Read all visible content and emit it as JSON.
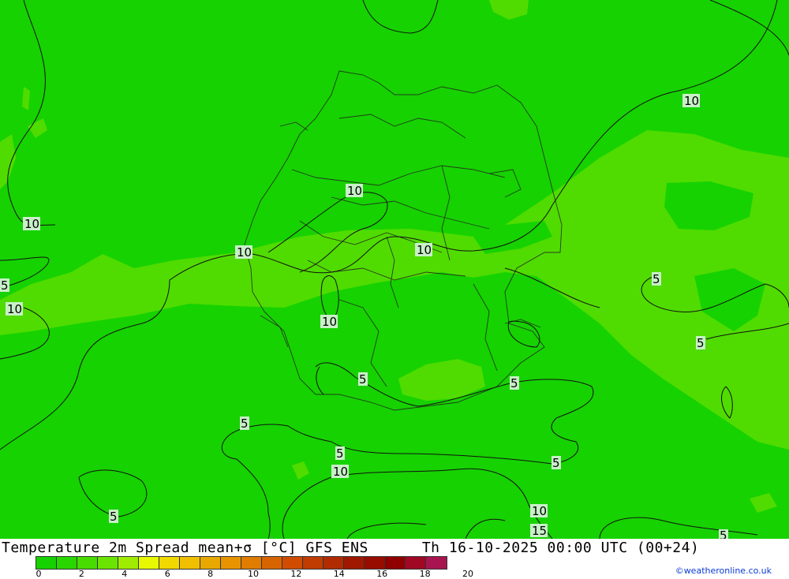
{
  "title": "Temperature 2m Spread mean+σ [°C] GFS ENS      Th 16-10-2025 00:00 UTC (00+24)",
  "credit": "©weatheronline.co.uk",
  "colors": {
    "background_green": "#16d200",
    "light_green": "#50dc00",
    "scale": [
      "#16d200",
      "#2ad600",
      "#48dc00",
      "#6ae400",
      "#a0ec00",
      "#e8f800",
      "#f0d800",
      "#f0c000",
      "#e8a800",
      "#e89400",
      "#e07c00",
      "#d86400",
      "#d04c00",
      "#c03c00",
      "#b02c00",
      "#a01800",
      "#980c00",
      "#900000",
      "#a00824",
      "#a81450"
    ]
  },
  "scale_ticks": [
    "0",
    "2",
    "4",
    "6",
    "8",
    "10",
    "12",
    "14",
    "16",
    "18",
    "20"
  ],
  "contour_labels": [
    "10",
    "10",
    "10",
    "10",
    "10",
    "5",
    "10",
    "10",
    "5",
    "5",
    "5",
    "5",
    "5",
    "5",
    "10",
    "5",
    "10",
    "15",
    "5",
    "5",
    "10"
  ]
}
